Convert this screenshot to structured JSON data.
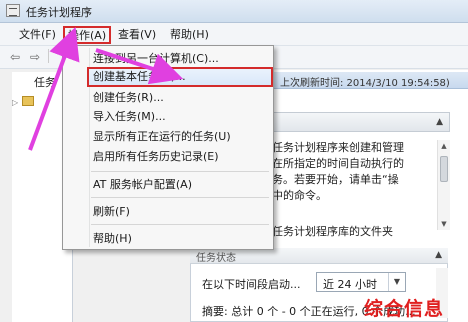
{
  "window": {
    "title": "任务计划程序"
  },
  "menubar": {
    "file": "文件(F)",
    "action": "操作(A)",
    "view": "查看(V)",
    "help": "帮助(H)"
  },
  "toolbar": {
    "back_icon": "back-arrow-icon",
    "forward_icon": "forward-arrow-icon"
  },
  "tree": {
    "root_label": "任务"
  },
  "action_menu": {
    "items": [
      "连接到另一台计算机(C)...",
      "创建基本任务(B)...",
      "创建任务(R)...",
      "导入任务(M)...",
      "显示所有正在运行的任务(U)",
      "启用所有任务历史记录(E)",
      "AT 服务帐户配置(A)",
      "刷新(F)",
      "帮助(H)"
    ],
    "highlighted_index": 1
  },
  "summary": {
    "last_refresh": "上次刷新时间: 2014/3/10 19:54:58)",
    "description": "任务计划程序来创建和管理\n在所指定的时间自动执行的\n务。若要开始，请单击“操\n中的命令。",
    "trailing_fragment": "任务计划程序库的文件夹"
  },
  "task_status": {
    "header": "任务状态",
    "period_label": "在以下时间段启动...",
    "period_value": "近 24 小时",
    "summary_line": "摘要: 总计 0 个 - 0 个正在运行, 0 个成功..."
  },
  "watermark": "综合信息",
  "colors": {
    "highlight_border": "#d42b2b",
    "annotation_arrow": "#e040e0"
  }
}
